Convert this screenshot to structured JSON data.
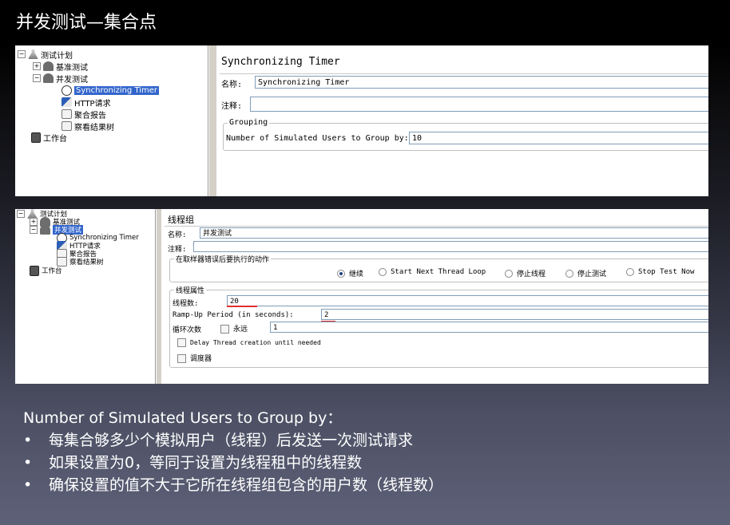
{
  "slide": {
    "title": "并发测试—集合点",
    "heading": "Number of Simulated Users to Group by：",
    "bullets": [
      "每集合够多少个模拟用户（线程）后发送一次测试请求",
      "如果设置为0，等同于设置为线程租中的线程数",
      "确保设置的值不大于它所在线程组包含的用户数（线程数）"
    ],
    "bullet_symbol": "•"
  },
  "panel1": {
    "tree": {
      "test_plan": "测试计划",
      "baseline": "基准测试",
      "concurrent": "并发测试",
      "sync_timer": "Synchronizing Timer",
      "http": "HTTP请求",
      "aggregate": "聚合报告",
      "results_tree": "察看结果树",
      "workbench": "工作台",
      "expand_plus": "+",
      "expand_minus": "−"
    },
    "form": {
      "title": "Synchronizing Timer",
      "name_label": "名称:",
      "name_value": "Synchronizing Timer",
      "comment_label": "注释:",
      "comment_value": "",
      "grouping_label": "Grouping",
      "users_label": "Number of Simulated Users to Group by:",
      "users_value": "10"
    }
  },
  "panel2": {
    "tree": {
      "test_plan": "测试计划",
      "baseline": "基准测试",
      "concurrent": "并发测试",
      "sync_timer": "Synchronizing Timer",
      "http": "HTTP请求",
      "aggregate": "聚合报告",
      "results_tree": "察看结果树",
      "workbench": "工作台",
      "expand_plus": "+",
      "expand_minus": "−"
    },
    "form": {
      "title": "线程组",
      "name_label": "名称:",
      "name_value": "并发测试",
      "comment_label": "注释:",
      "error_action_label": "在取样器错误后要执行的动作",
      "radios": [
        "继续",
        "Start Next Thread Loop",
        "停止线程",
        "停止测试",
        "Stop Test Now"
      ],
      "selected_radio": "继续",
      "thread_props_label": "线程属性",
      "threads_label": "线程数:",
      "threads_value": "20",
      "rampup_label": "Ramp-Up Period (in seconds):",
      "rampup_value": "2",
      "loop_label": "循环次数",
      "forever_label": "永远",
      "loop_value": "1",
      "delay_label": "Delay Thread creation until needed",
      "scheduler_label": "调度器"
    }
  }
}
